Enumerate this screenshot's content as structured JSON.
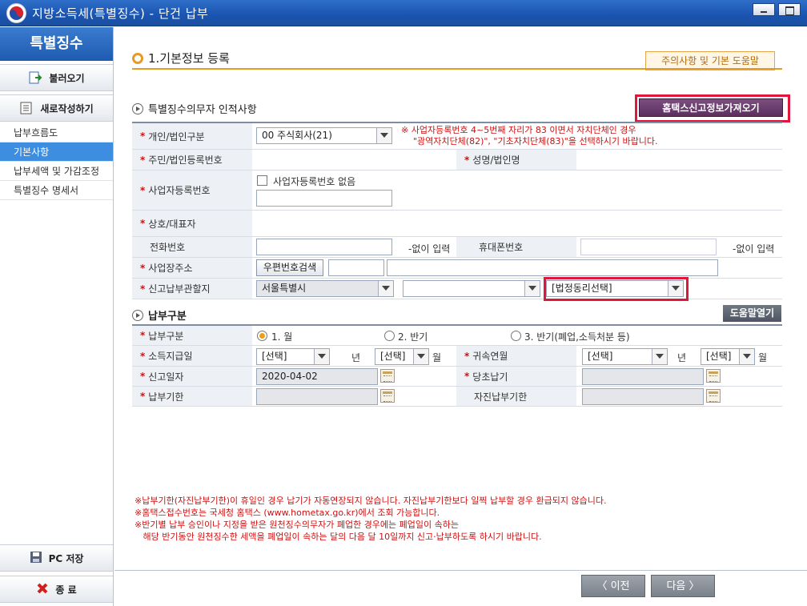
{
  "window": {
    "title": "지방소득세(특별징수) - 단건 납부"
  },
  "sidebar": {
    "header": "특별징수",
    "load_button": "불러오기",
    "new_button": "새로작성하기",
    "items": [
      {
        "label": "납부흐름도",
        "active": false
      },
      {
        "label": "기본사항",
        "active": true
      },
      {
        "label": "납부세액 및 가감조정",
        "active": false
      },
      {
        "label": "특별징수 명세서",
        "active": false
      }
    ],
    "save_button": "PC 저장",
    "exit_button": "종 료"
  },
  "main": {
    "page_title": "1.기본정보 등록",
    "help_link": "주의사항 및 기본 도움말",
    "section1_title": "특별징수의무자 인적사항",
    "hometax_button": "홈택스신고정보가져오기",
    "labels": {
      "person_type": "개인/법인구분",
      "reg_no": "주민/법인등록번호",
      "name": "성명/법인명",
      "biz_no": "사업자등록번호",
      "company": "상호/대표자",
      "phone": "전화번호",
      "mobile": "휴대폰번호",
      "address": "사업장주소",
      "office": "신고납부관할지"
    },
    "person_type_value": "00 주식회사(21)",
    "person_note": "※  사업자등록번호 4~5번째 자리가 83 이면서 자치단체인 경우",
    "person_note2": "\"광역자치단체(82)\", \"기초자치단체(83)\"을 선택하시기 바랍니다.",
    "no_biz_no_label": "사업자등록번호 없음",
    "no_dash_1": "-없이 입력",
    "no_dash_2": "-없이 입력",
    "zip_search": "우편번호검색",
    "office_city": "서울특별시",
    "office_dong": "[법정동리선택]",
    "section2_title": "납부구분",
    "help_open": "도움말열기",
    "pay_labels": {
      "pay_type": "납부구분",
      "pay_date": "소득지급일",
      "belong": "귀속연월",
      "report_date": "신고일자",
      "original": "당초납기",
      "deadline": "납부기한",
      "self_deadline": "자진납부기한"
    },
    "radio_options": [
      "1. 월",
      "2. 반기",
      "3. 반기(폐업,소득처분 등)"
    ],
    "select_placeholder": "[선택]",
    "year_unit": "년",
    "month_unit": "월",
    "report_date_value": "2020-04-02",
    "notes": [
      "※납부기한(자진납부기한)이 휴일인 경우 납기가 자동연장되지 않습니다. 자진납부기한보다 일찍 납부할 경우 환급되지 않습니다.",
      "※홈택스접수번호는 국세청 홈택스 (www.hometax.go.kr)에서 조회 가능합니다.",
      "※반기별 납부 승인이나 지정을 받은 원천징수의무자가 폐업한 경우에는 폐업일이 속하는",
      "   해당 반기동안 원천징수한 세액을 폐업일이 속하는 달의 다음 달 10일까지 신고·납부하도록 하시기 바랍니다."
    ],
    "prev_button": "〈  이전",
    "next_button": "다음  〉"
  },
  "colors": {
    "accent_orange": "#e89b22",
    "alert_red": "#e0163a",
    "sidebar_active": "#3d8ee0"
  }
}
